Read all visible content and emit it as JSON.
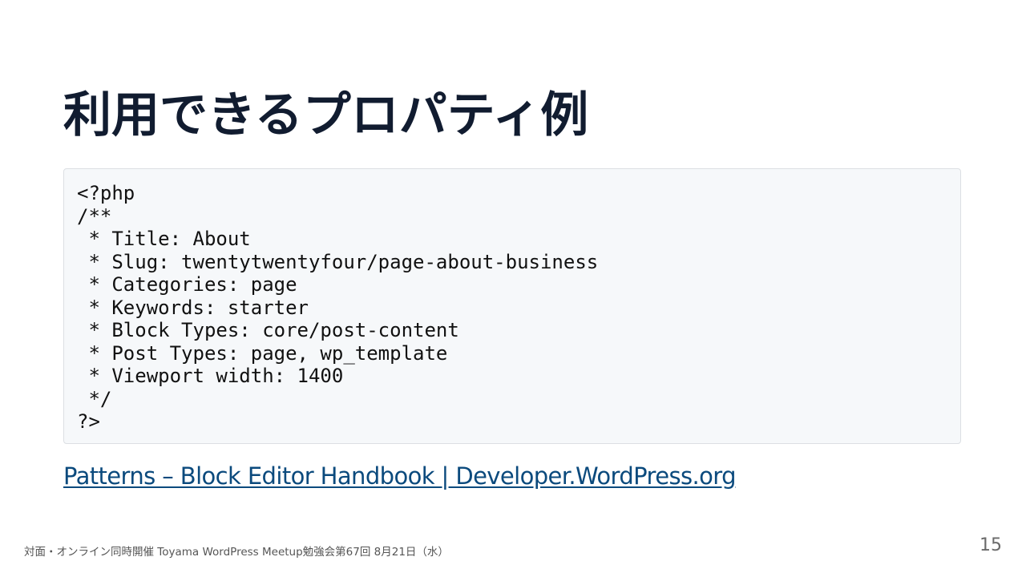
{
  "slide": {
    "title": "利用できるプロパティ例",
    "code_lines": [
      "<?php",
      "/**",
      " * Title: About",
      " * Slug: twentytwentyfour/page-about-business",
      " * Categories: page",
      " * Keywords: starter",
      " * Block Types: core/post-content",
      " * Post Types: page, wp_template",
      " * Viewport width: 1400",
      " */",
      "?>"
    ],
    "link_text": "Patterns – Block Editor Handbook | Developer.WordPress.org",
    "footer": "対面・オンライン同時開催 Toyama WordPress Meetup勉強会第67回 8月21日（水）",
    "page_number": "15"
  },
  "colors": {
    "title": "#111c30",
    "code_background": "#f6f8fa",
    "code_border": "#dcdfe3",
    "link": "#0b4a7d",
    "footer": "#555555",
    "page_number": "#6a6a6a"
  }
}
